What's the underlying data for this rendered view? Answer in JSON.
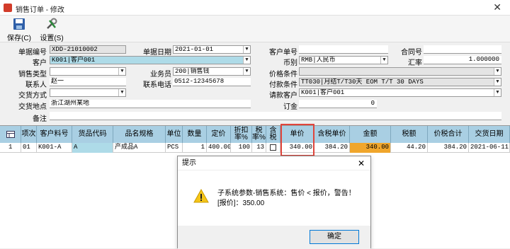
{
  "window": {
    "title": "销售订单 - 修改",
    "close": "✕"
  },
  "toolbar": {
    "save_label": "保存(C)",
    "settings_label": "设置(S)"
  },
  "form": {
    "order_no_label": "单据编号",
    "order_no": "XDD-21010002",
    "order_date_label": "单据日期",
    "order_date": "2021-01-01",
    "customer_order_label": "客户单号",
    "customer_order": "",
    "contract_no_label": "合同号",
    "contract_no": "",
    "customer_label": "客户",
    "customer": "K001|客户001",
    "currency_label": "币别",
    "currency": "RMB|人民币",
    "rate_label": "汇率",
    "rate": "1.000000",
    "sales_type_label": "销售类型",
    "sales_type": "",
    "salesman_label": "业务员",
    "salesman": "200|销售钱",
    "price_cond_label": "价格条件",
    "price_cond": "",
    "contact_label": "联系人",
    "contact": "赵一",
    "contact_phone_label": "联系电话",
    "contact_phone": "0512-12345678",
    "payment_label": "付款条件",
    "payment": "TT030|月结T/T30天 EOM T/T 30 DAYS",
    "delivery_method_label": "交货方式",
    "delivery_method": "",
    "bill_customer_label": "请款客户",
    "bill_customer": "K001|客户001",
    "delivery_place_label": "交货地点",
    "delivery_place": "浙江湖州某地",
    "deposit_label": "订金",
    "deposit": "0",
    "remarks_label": "备注",
    "remarks": ""
  },
  "grid": {
    "headers": [
      "项次",
      "客户料号",
      "货品代码",
      "品名规格",
      "单位",
      "数量",
      "定价",
      "折扣率%",
      "税率%",
      "含税",
      "单价",
      "含税单价",
      "金额",
      "税额",
      "价税合计",
      "交货日期"
    ],
    "row": {
      "row_no": "1",
      "item": "01",
      "cust_part": "K001-A",
      "product_code": "A",
      "name_spec": "产成品A",
      "unit": "PCS",
      "qty": "1",
      "list_price": "400.00",
      "discount": "100",
      "tax_rate": "13",
      "unit_price": "340.00",
      "tax_unit_price": "384.20",
      "amount": "340.00",
      "tax_amount": "44.20",
      "total": "384.20",
      "delivery_date": "2021-06-11"
    }
  },
  "dialog": {
    "title": "提示",
    "close": "✕",
    "line1": "子系统参数-销售系统：售价 < 报价，警告！",
    "line2": "[报价]：350.00",
    "ok_label": "确定"
  },
  "colors": {
    "header_blue": "#a9cfe3",
    "field_blue": "#aedbe8",
    "amount_orange": "#f0a62c",
    "highlight_red": "#e0453c",
    "warning_yellow": "#f5c518"
  }
}
